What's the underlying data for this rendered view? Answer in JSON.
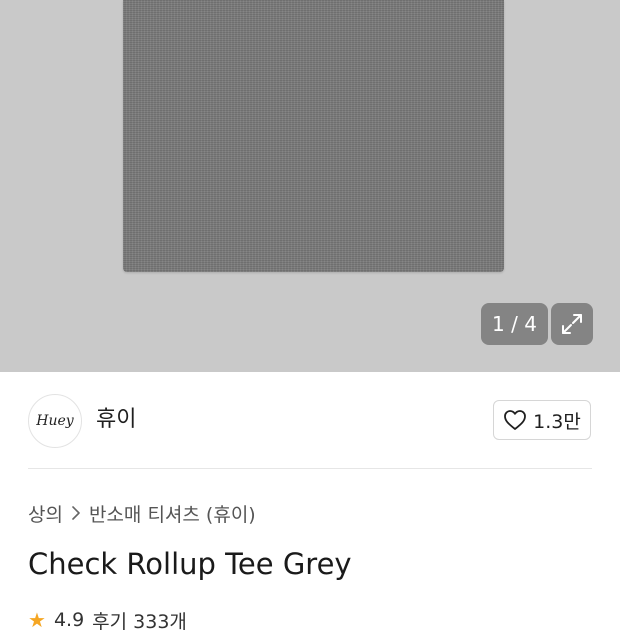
{
  "gallery": {
    "counter_text": "1 / 4",
    "expand_icon": "expand-icon"
  },
  "store": {
    "logo_text": "Huey",
    "name": "휴이",
    "like_icon": "heart-icon",
    "like_count": "1.3만"
  },
  "breadcrumb": {
    "category": "상의",
    "separator_icon": "chevron-right-icon",
    "subcategory": "반소매 티셔츠 (휴이)"
  },
  "product": {
    "title": "Check Rollup Tee Grey"
  },
  "rating": {
    "star_icon": "star-icon",
    "score": "4.9",
    "reviews_text": "후기 333개"
  },
  "colors": {
    "hero_bg": "#c9c9c9",
    "shirt": "#7a7a7a",
    "accent_star": "#f5a623",
    "overlay": "#787878"
  }
}
